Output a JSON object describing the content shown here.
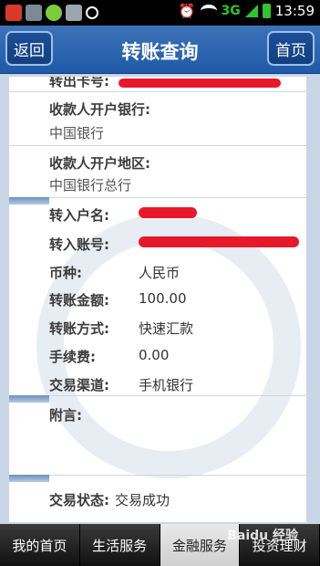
{
  "status_bar": {
    "network": "3G",
    "time": "13:59",
    "icons": [
      "sogou-icon",
      "gallery-icon",
      "android-icon",
      "storage-icon",
      "pin-icon",
      "alarm-icon",
      "wifi-icon",
      "signal-icon",
      "battery-icon"
    ]
  },
  "header": {
    "back_label": "返回",
    "title": "转账查询",
    "home_label": "首页"
  },
  "details": {
    "partial_top_label": "转出卡号:",
    "payee_bank_label": "收款人开户银行:",
    "payee_bank_value": "中国银行",
    "payee_region_label": "收款人开户地区:",
    "payee_region_value": "中国银行总行",
    "rows": [
      {
        "label": "转入户名:",
        "value": ""
      },
      {
        "label": "转入账号:",
        "value": ""
      },
      {
        "label": "币种:",
        "value": "人民币"
      },
      {
        "label": "转账金额:",
        "value": "100.00"
      },
      {
        "label": "转账方式:",
        "value": "快速汇款"
      },
      {
        "label": "手续费:",
        "value": "0.00"
      },
      {
        "label": "交易渠道:",
        "value": "手机银行"
      }
    ],
    "remark_label": "附言:",
    "status_label": "交易状态:",
    "status_value": "交易成功"
  },
  "bottom_nav": {
    "items": [
      "我的首页",
      "生活服务",
      "金融服务",
      "投资理财"
    ],
    "active_index": 2
  },
  "colors": {
    "header_blue": "#2a63b0",
    "redaction_red": "#e8182b"
  },
  "watermark_text": "Baidu 经验"
}
